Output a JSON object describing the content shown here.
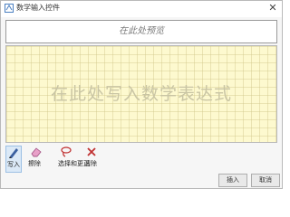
{
  "window": {
    "title": "数学输入控件",
    "close_glyph": "✕"
  },
  "preview": {
    "placeholder": "在此处预览"
  },
  "canvas": {
    "placeholder": "在此处写入数学表达式"
  },
  "toolbar": {
    "tools": [
      {
        "label": "写入",
        "icon": "pen-icon",
        "selected": true
      },
      {
        "label": "擦除",
        "icon": "eraser-icon",
        "selected": false
      },
      {
        "label": "选择和更正",
        "icon": "lasso-icon",
        "selected": false
      },
      {
        "label": "清除",
        "icon": "clear-icon",
        "selected": false
      }
    ]
  },
  "buttons": {
    "insert": "插入",
    "cancel": "取消"
  },
  "colors": {
    "canvas_bg": "#fdf9cf",
    "selected_tool_bg": "#dbe9f7"
  }
}
